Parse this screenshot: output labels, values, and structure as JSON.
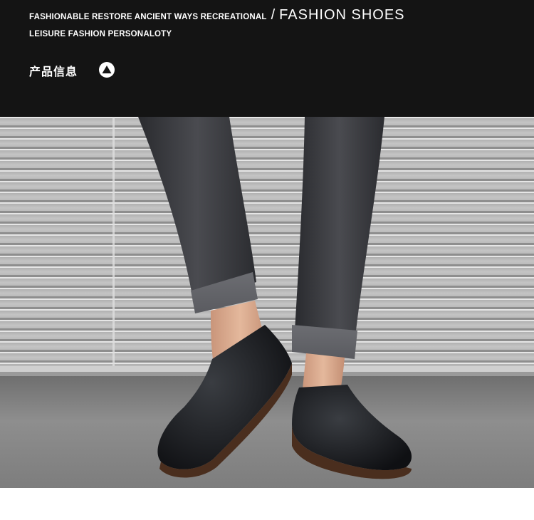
{
  "header": {
    "tagline": "FASHIONABLE RESTORE ANCIENT WAYS RECREATIONAL",
    "separator": "/",
    "title": "FASHION SHOES",
    "subline": "LEISURE FASHION PERSONALOTY",
    "section_label": "产品信息",
    "section_icon": "triangle-up-icon"
  },
  "photo": {
    "subject": "product-photo",
    "colors": {
      "background_band": "#141414",
      "wall": "#b9b9b9",
      "floor": "#8a8a8a",
      "denim": "#3a3b3f",
      "shoe": "#16181b",
      "sole": "#4a2e1e",
      "skin": "#d9ab8c"
    }
  }
}
